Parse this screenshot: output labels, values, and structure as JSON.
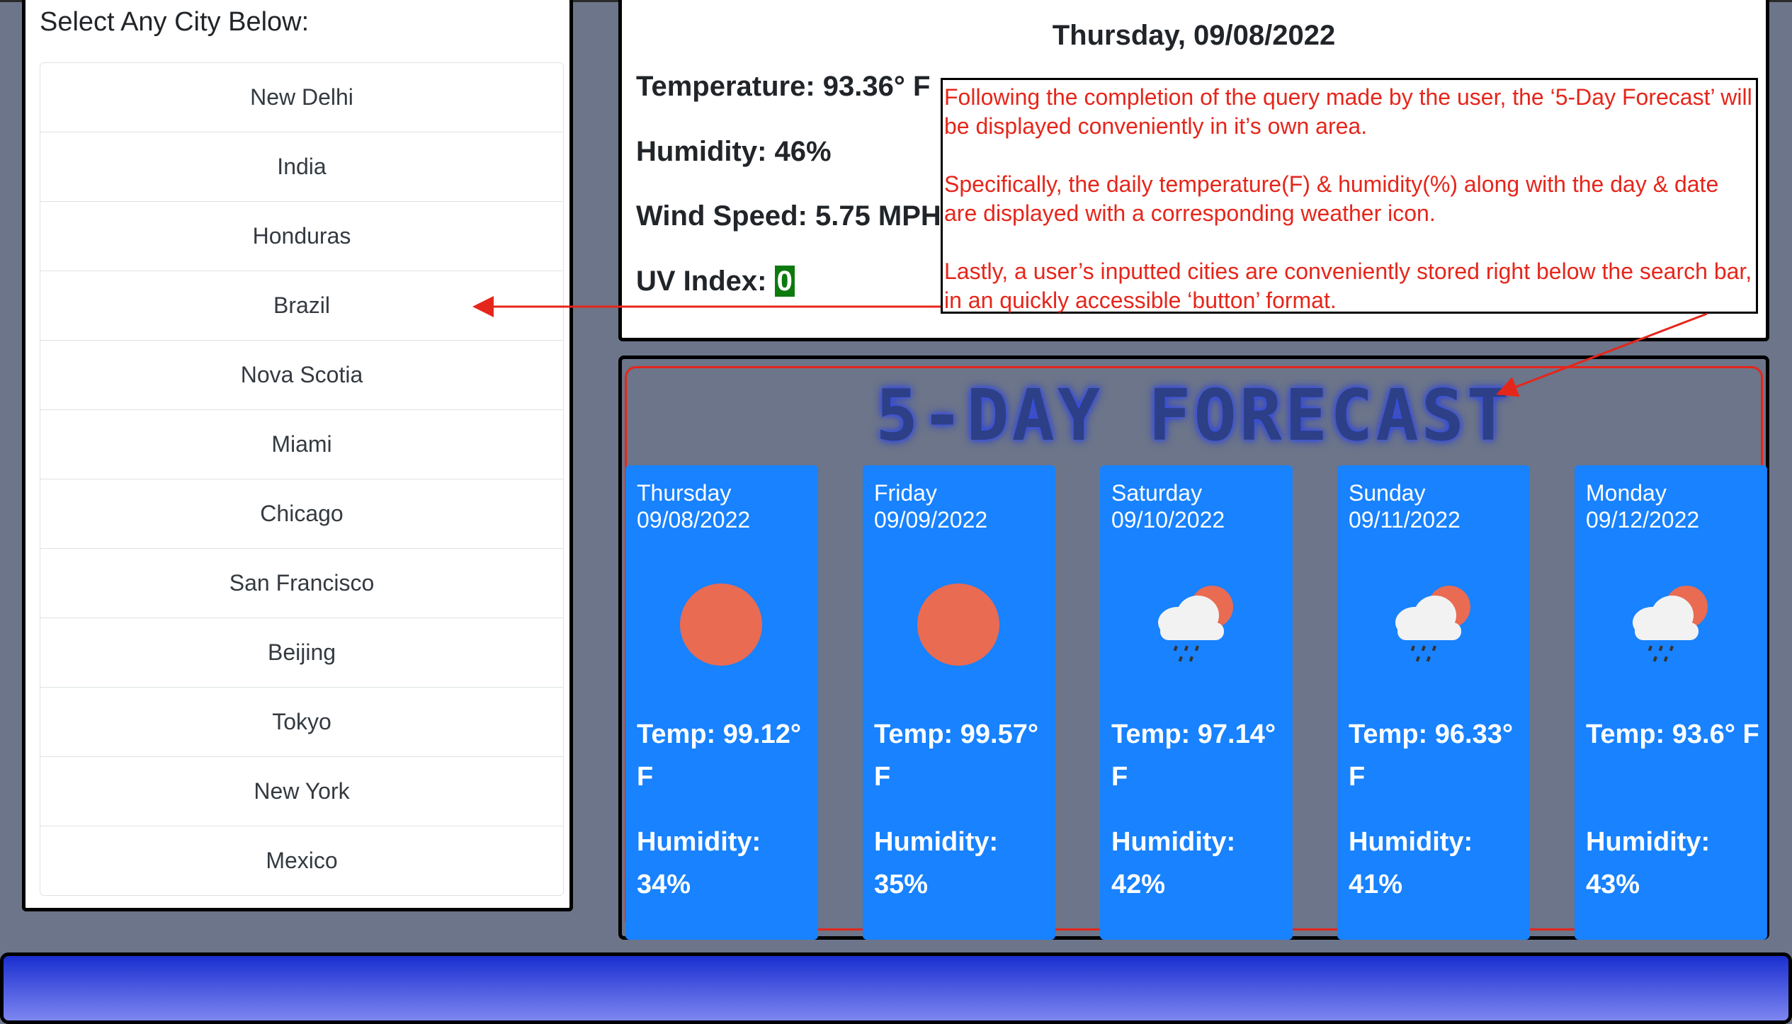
{
  "sidebar": {
    "title": "Select Any City Below:",
    "cities": [
      "New Delhi",
      "India",
      "Honduras",
      "Brazil",
      "Nova Scotia",
      "Miami",
      "Chicago",
      "San Francisco",
      "Beijing",
      "Tokyo",
      "New York",
      "Mexico"
    ]
  },
  "current": {
    "date": "Thursday, 09/08/2022",
    "temperature": "Temperature: 93.36° F",
    "humidity": "Humidity: 46%",
    "wind": "Wind Speed: 5.75 MPH",
    "uv_label": "UV Index:",
    "uv_value": "0",
    "uv_color": "#0d7a0d"
  },
  "annotation": {
    "p1": "Following the completion of the query made by the user, the ‘5-Day Forecast’ will be displayed conveniently in it’s own area.",
    "p2": "Specifically, the daily temperature(F) & humidity(%) along with the day & date are displayed with a corresponding weather icon.",
    "p3": "Lastly, a user’s inputted cities are conveniently stored right below the search bar, in an quickly accessible ‘button’ format.",
    "color": "#e5261b"
  },
  "forecast": {
    "title": "5-DAY FORECAST",
    "days": [
      {
        "day": "Thursday",
        "date": "09/08/2022",
        "icon": "sun-icon",
        "temp": "Temp: 99.12° F",
        "humidity": "Humidity: 34%"
      },
      {
        "day": "Friday",
        "date": "09/09/2022",
        "icon": "sun-icon",
        "temp": "Temp: 99.57° F",
        "humidity": "Humidity: 35%"
      },
      {
        "day": "Saturday",
        "date": "09/10/2022",
        "icon": "rain-cloud-sun-icon",
        "temp": "Temp: 97.14° F",
        "humidity": "Humidity: 42%"
      },
      {
        "day": "Sunday",
        "date": "09/11/2022",
        "icon": "rain-cloud-sun-icon",
        "temp": "Temp: 96.33° F",
        "humidity": "Humidity: 41%"
      },
      {
        "day": "Monday",
        "date": "09/12/2022",
        "icon": "rain-cloud-sun-icon",
        "temp": "Temp: 93.6° F",
        "humidity": "Humidity: 43%"
      }
    ],
    "card_color": "#1882ff"
  }
}
